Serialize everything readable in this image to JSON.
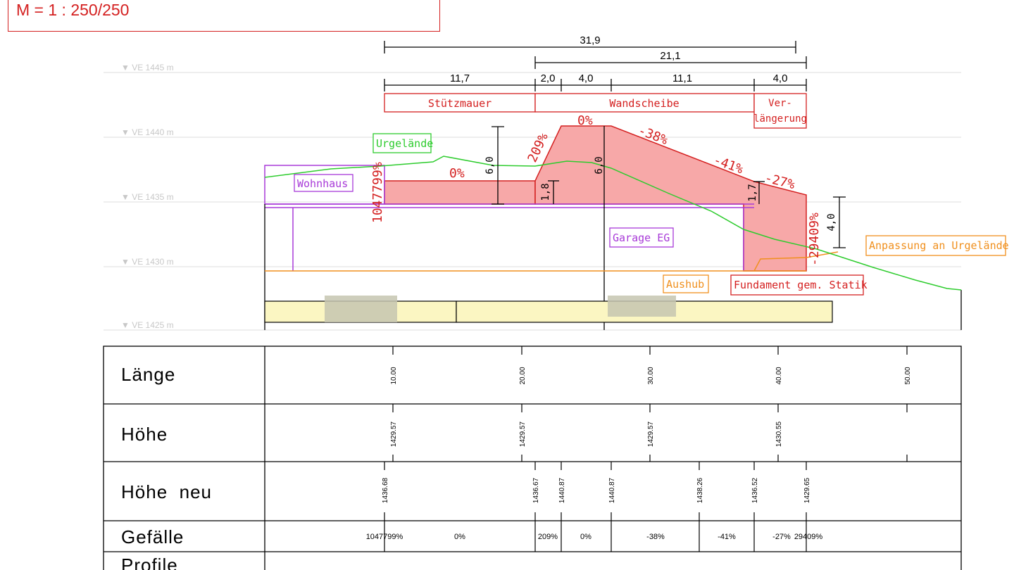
{
  "scale": "M = 1 : 250/250",
  "levels": [
    "▼ VE 1445 m",
    "▼ VE 1440 m",
    "▼ VE 1435 m",
    "▼ VE 1430 m",
    "▼ VE 1425 m"
  ],
  "dimensions": {
    "total": "31,9",
    "wall": "21,1",
    "segments": [
      "11,7",
      "2,0",
      "4,0",
      "11,1",
      "4,0"
    ],
    "heights": [
      "6,0",
      "1,8",
      "6,0",
      "1,7",
      "4,0"
    ]
  },
  "sections": {
    "stuetzmauer": "Stützmauer",
    "wandscheibe": "Wandscheibe",
    "verlaengerung_1": "Ver-",
    "verlaengerung_2": "längerung"
  },
  "slopes": [
    "0%",
    "209%",
    "0%",
    "-38%",
    "-41%",
    "-27%",
    "1047799%",
    "-29409%"
  ],
  "labels": {
    "urgelaende": "Urgelände",
    "wohnhaus": "Wohnhaus",
    "garage": "Garage EG",
    "aushub": "Aushub",
    "fundament": "Fundament gem. Statik",
    "anpassung": "Anpassung an Urgelände"
  },
  "colors": {
    "red": "#d42020",
    "fill": "#f7a8a8",
    "green": "#2ecc2e",
    "purple": "#a83ad8",
    "orange": "#f0901e",
    "yellow": "#fbf6c2"
  },
  "table": {
    "rows": [
      "Länge",
      "Höhe",
      "Höhe  neu",
      "Gefälle",
      "Profile"
    ],
    "laenge": [
      "10.00",
      "20.00",
      "30.00",
      "40.00",
      "50.00"
    ],
    "hoehe": [
      "1429.57",
      "1429.57",
      "1429.57",
      "1430.55"
    ],
    "hoehe_neu": [
      "1436.68",
      "1436.67",
      "1440.87",
      "1440.87",
      "1438.26",
      "1436.52",
      "1429.65"
    ],
    "gefaelle": [
      "1047799%",
      "0%",
      "209%",
      "0%",
      "-38%",
      "-41%",
      "-27%",
      "29409%"
    ]
  }
}
